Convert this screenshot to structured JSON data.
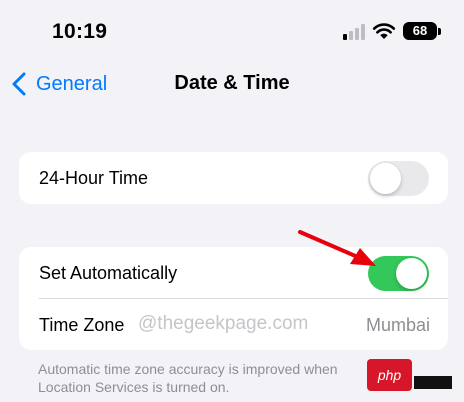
{
  "status_bar": {
    "time": "10:19",
    "battery": "68"
  },
  "nav": {
    "back_label": "General",
    "title": "Date & Time"
  },
  "settings": {
    "hour24": {
      "label": "24-Hour Time",
      "enabled": false
    },
    "set_automatically": {
      "label": "Set Automatically",
      "enabled": true
    },
    "time_zone": {
      "label": "Time Zone",
      "value": "Mumbai"
    }
  },
  "footnote": "Automatic time zone accuracy is improved when Location Services is turned on.",
  "watermark": "@thegeekpage.com",
  "logo": {
    "text": "php"
  },
  "colors": {
    "accent": "#007aff",
    "toggle_on": "#34c759",
    "toggle_off": "#e9e9eb",
    "annotation_arrow": "#e8000b"
  },
  "icons": [
    "signal-icon",
    "wifi-icon",
    "battery-icon",
    "chevron-left-icon",
    "arrow-annotation-icon"
  ]
}
